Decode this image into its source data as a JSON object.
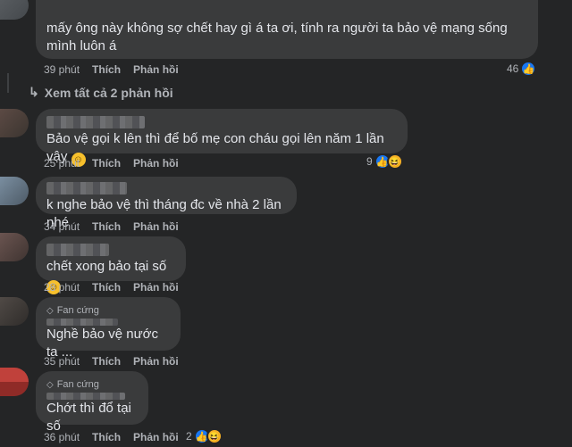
{
  "comments": [
    {
      "text": "mấy ông này không sợ chết hay gì á ta ơi, tính ra người ta bảo vệ mạng sống mình luôn á",
      "time": "39 phút",
      "like": "Thích",
      "reply": "Phản hồi",
      "react_count": "46"
    },
    {
      "text": "Bảo vệ gọi k lên thì để bố mẹ con cháu gọi lên năm 1 lần vậy",
      "time": "25 phút",
      "like": "Thích",
      "reply": "Phản hồi",
      "react_count": "9"
    },
    {
      "text": "k nghe bảo vệ thì tháng đc về nhà 2 lần nhé",
      "time": "34 phút",
      "like": "Thích",
      "reply": "Phản hồi"
    },
    {
      "text": "chết xong bảo tại số",
      "time": "28 phút",
      "like": "Thích",
      "reply": "Phản hồi"
    },
    {
      "badge": "Fan cứng",
      "text": "Nghề bảo vệ nước ta ...",
      "time": "35 phút",
      "like": "Thích",
      "reply": "Phản hồi"
    },
    {
      "badge": "Fan cứng",
      "text": "Chớt thì đổ tại số",
      "time": "36 phút",
      "like": "Thích",
      "reply": "Phản hồi",
      "react_count": "2"
    }
  ],
  "see_all": "Xem tất cả 2 phản hồi",
  "colors": {
    "background": "#242526",
    "bubble": "#3a3b3c",
    "text": "#e4e6eb",
    "muted": "#b0b3b8",
    "like_blue": "#1877f2",
    "haha_yellow": "#f7b125"
  },
  "icons": [
    "like-icon",
    "haha-icon",
    "smile-emoji-icon",
    "diamond-icon",
    "reply-arrow-icon"
  ]
}
